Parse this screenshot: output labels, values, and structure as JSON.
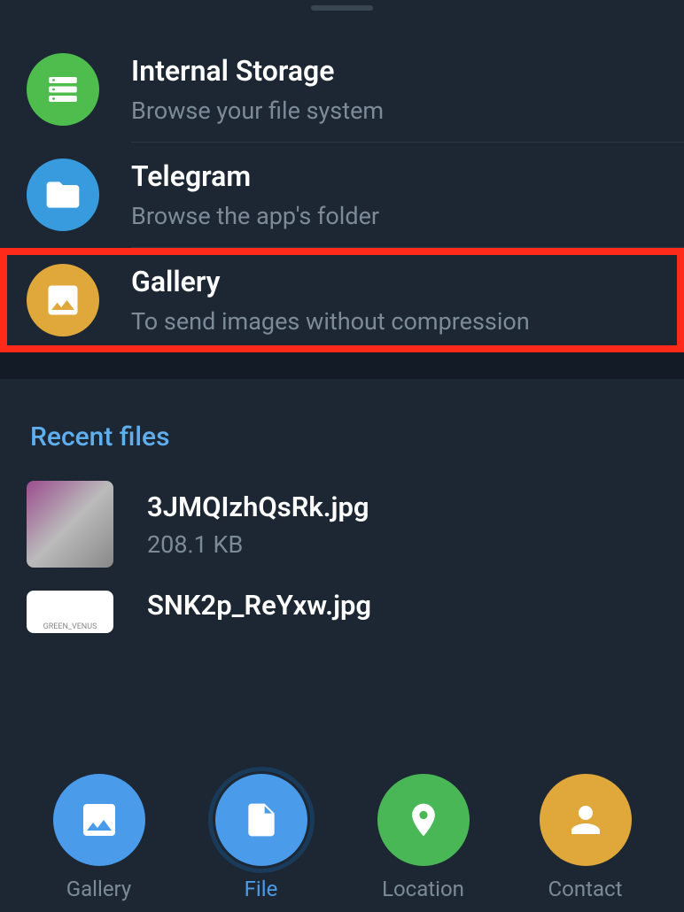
{
  "sources": [
    {
      "title": "Internal Storage",
      "subtitle": "Browse your file system",
      "iconColor": "green",
      "icon": "storage",
      "highlighted": false
    },
    {
      "title": "Telegram",
      "subtitle": "Browse the app's folder",
      "iconColor": "blue",
      "icon": "folder",
      "highlighted": false
    },
    {
      "title": "Gallery",
      "subtitle": "To send images without compression",
      "iconColor": "yellow",
      "icon": "image",
      "highlighted": true
    }
  ],
  "recent": {
    "header": "Recent files",
    "files": [
      {
        "name": "3JMQIzhQsRk.jpg",
        "size": "208.1 KB"
      },
      {
        "name": "SNK2p_ReYxw.jpg",
        "size": ""
      }
    ]
  },
  "nav": [
    {
      "label": "Gallery",
      "icon": "image",
      "color": "blue",
      "active": false
    },
    {
      "label": "File",
      "icon": "file",
      "color": "blue",
      "active": true
    },
    {
      "label": "Location",
      "icon": "location",
      "color": "green",
      "active": false
    },
    {
      "label": "Contact",
      "icon": "contact",
      "color": "yellow",
      "active": false
    }
  ]
}
